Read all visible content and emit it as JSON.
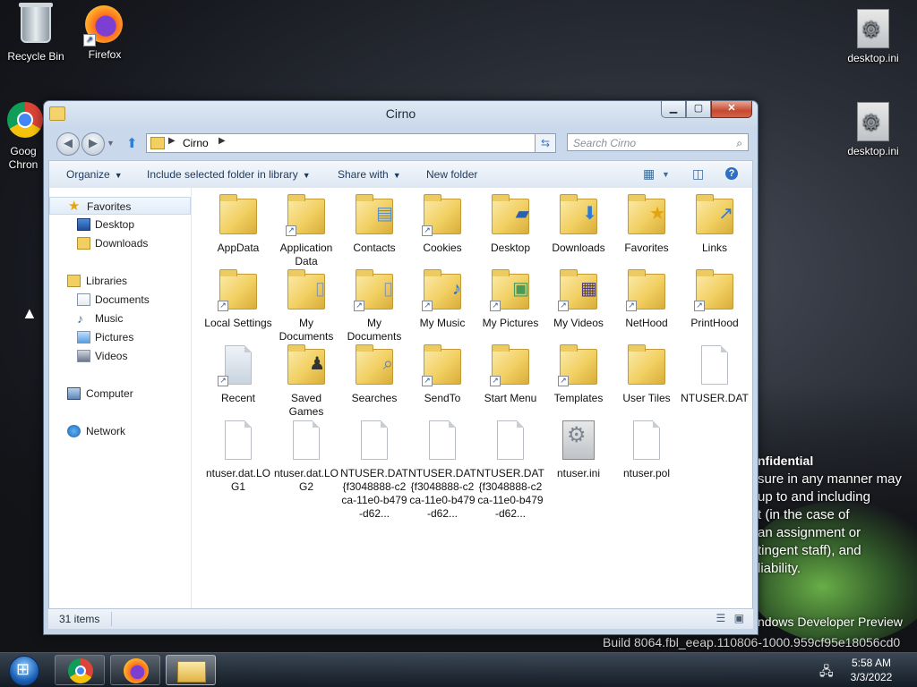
{
  "desktop": {
    "icons": [
      {
        "label": "Recycle Bin"
      },
      {
        "label": "Firefox"
      },
      {
        "label": "Goog Chron"
      },
      {
        "label": "desktop.ini"
      },
      {
        "label": "desktop.ini"
      }
    ],
    "watermark_lines": [
      "nfidential",
      "sure in any manner may",
      "up to and including",
      "t (in the case of",
      "an assignment or",
      "tingent staff), and",
      "liability."
    ],
    "build_line1": "ndows Developer Preview",
    "build_line2": "Build 8064.fbl_eeap.110806-1000.959cf95e18056cd0"
  },
  "window": {
    "title": "Cirno",
    "address_crumb": "Cirno",
    "search_placeholder": "Search Cirno",
    "commands": {
      "organize": "Organize",
      "include": "Include selected folder in library",
      "share": "Share with",
      "new_folder": "New folder"
    },
    "nav": {
      "favorites": "Favorites",
      "desktop": "Desktop",
      "downloads": "Downloads",
      "libraries": "Libraries",
      "documents": "Documents",
      "music": "Music",
      "pictures": "Pictures",
      "videos": "Videos",
      "computer": "Computer",
      "network": "Network"
    },
    "items": [
      {
        "name": "AppData",
        "kind": "folder"
      },
      {
        "name": "Application Data",
        "kind": "folder-shortcut"
      },
      {
        "name": "Contacts",
        "kind": "folder"
      },
      {
        "name": "Cookies",
        "kind": "folder-shortcut"
      },
      {
        "name": "Desktop",
        "kind": "folder"
      },
      {
        "name": "Downloads",
        "kind": "folder"
      },
      {
        "name": "Favorites",
        "kind": "folder"
      },
      {
        "name": "Links",
        "kind": "folder"
      },
      {
        "name": "Local Settings",
        "kind": "folder-shortcut"
      },
      {
        "name": "My Documents",
        "kind": "folder"
      },
      {
        "name": "My Documents",
        "kind": "folder-shortcut"
      },
      {
        "name": "My Music",
        "kind": "folder-shortcut"
      },
      {
        "name": "My Pictures",
        "kind": "folder-shortcut"
      },
      {
        "name": "My Videos",
        "kind": "folder-shortcut"
      },
      {
        "name": "NetHood",
        "kind": "folder-shortcut"
      },
      {
        "name": "PrintHood",
        "kind": "folder-shortcut"
      },
      {
        "name": "Recent",
        "kind": "shortcut"
      },
      {
        "name": "Saved Games",
        "kind": "folder"
      },
      {
        "name": "Searches",
        "kind": "folder"
      },
      {
        "name": "SendTo",
        "kind": "folder-shortcut"
      },
      {
        "name": "Start Menu",
        "kind": "folder-shortcut"
      },
      {
        "name": "Templates",
        "kind": "folder-shortcut"
      },
      {
        "name": "User Tiles",
        "kind": "folder"
      },
      {
        "name": "NTUSER.DAT",
        "kind": "file"
      },
      {
        "name": "ntuser.dat.LOG1",
        "kind": "file"
      },
      {
        "name": "ntuser.dat.LOG2",
        "kind": "file"
      },
      {
        "name": "NTUSER.DAT{f3048888-c2ca-11e0-b479-d62...",
        "kind": "file"
      },
      {
        "name": "NTUSER.DAT{f3048888-c2ca-11e0-b479-d62...",
        "kind": "file"
      },
      {
        "name": "NTUSER.DAT{f3048888-c2ca-11e0-b479-d62...",
        "kind": "file"
      },
      {
        "name": "ntuser.ini",
        "kind": "settings-file"
      },
      {
        "name": "ntuser.pol",
        "kind": "file"
      }
    ],
    "status": "31 items"
  },
  "taskbar": {
    "time": "5:58 AM",
    "date": "3/3/2022"
  }
}
